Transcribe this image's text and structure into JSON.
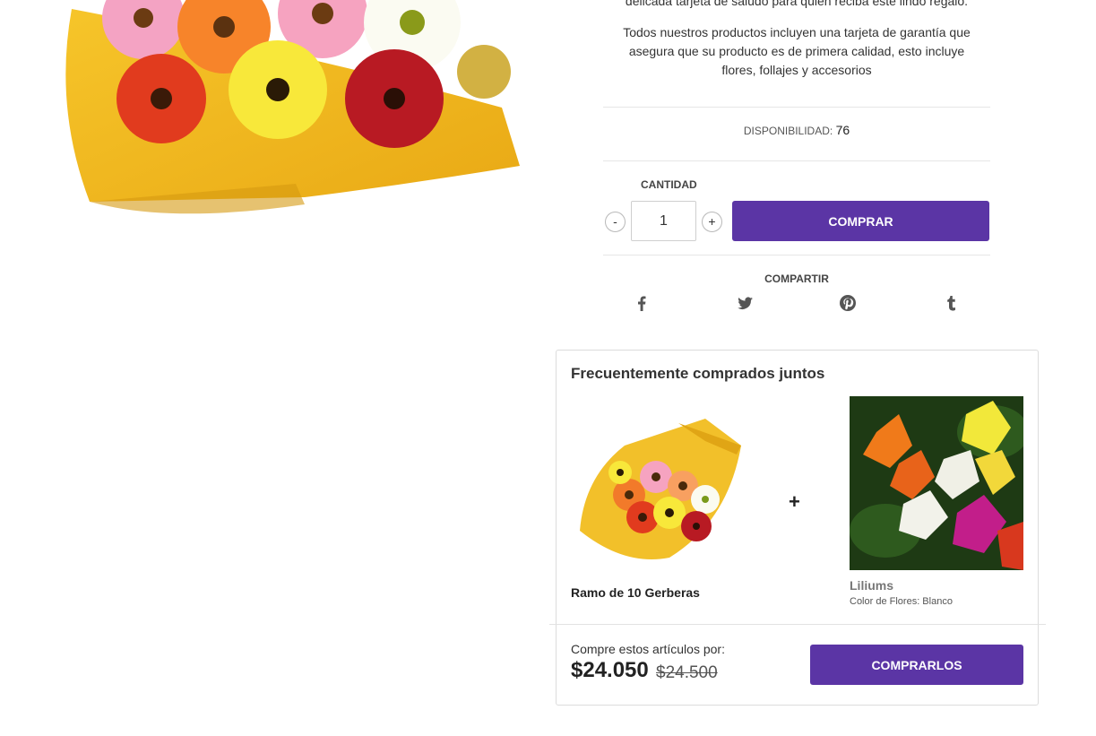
{
  "product": {
    "description_cut": "delicada tarjeta de saludo para quien reciba este lindo regalo.",
    "description": "Todos nuestros productos incluyen una tarjeta de garantía que asegura que su producto es de primera calidad, esto incluye flores, follajes y accesorios",
    "availability_label": "DISPONIBILIDAD:",
    "availability_value": "76",
    "quantity_label": "CANTIDAD",
    "quantity_value": "1",
    "minus_label": "-",
    "plus_label": "+",
    "buy_label": "COMPRAR",
    "share_label": "COMPARTIR",
    "share_icons": [
      "facebook-icon",
      "twitter-icon",
      "pinterest-icon",
      "tumblr-icon"
    ]
  },
  "bundle": {
    "title": "Frecuentemente comprados juntos",
    "plus": "+",
    "items": [
      {
        "name": "Ramo de 10 Gerberas"
      },
      {
        "name": "Liliums",
        "option": "Color de Flores: Blanco"
      }
    ],
    "buy_these_label": "Compre estos artículos por:",
    "price": "$24.050",
    "old_price": "$24.500",
    "buy_all_label": "COMPRARLOS"
  },
  "colors": {
    "accent": "#5b35a5"
  }
}
